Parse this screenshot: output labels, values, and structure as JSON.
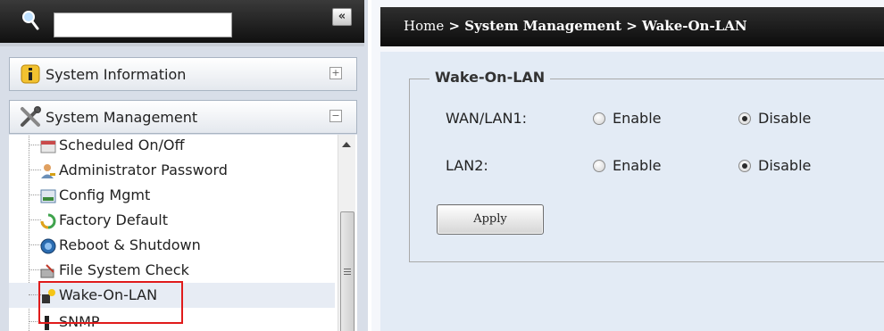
{
  "sidebar": {
    "search": {
      "value": "",
      "placeholder": ""
    },
    "collapse_label": "«",
    "sections": {
      "info": {
        "label": "System Information",
        "toggle": "+"
      },
      "mgmt": {
        "label": "System Management",
        "toggle": "−"
      }
    },
    "items": [
      {
        "label": "Scheduled On/Off"
      },
      {
        "label": "Administrator Password"
      },
      {
        "label": "Config Mgmt"
      },
      {
        "label": "Factory Default"
      },
      {
        "label": "Reboot & Shutdown"
      },
      {
        "label": "File System Check"
      },
      {
        "label": "Wake-On-LAN"
      },
      {
        "label": "SNMP"
      }
    ]
  },
  "breadcrumb": {
    "home": "Home",
    "sep1": " > ",
    "section": "System Management",
    "sep2": " > ",
    "page": "Wake-On-LAN"
  },
  "form": {
    "legend": "Wake-On-LAN",
    "rows": [
      {
        "label": "WAN/LAN1:",
        "options": [
          "Enable",
          "Disable"
        ],
        "selected": "Disable"
      },
      {
        "label": "LAN2:",
        "options": [
          "Enable",
          "Disable"
        ],
        "selected": "Disable"
      }
    ],
    "apply_label": "Apply"
  },
  "colors": {
    "highlight": "#e01b1b",
    "header_bg": "#111111",
    "content_bg": "#e3ebf5"
  }
}
